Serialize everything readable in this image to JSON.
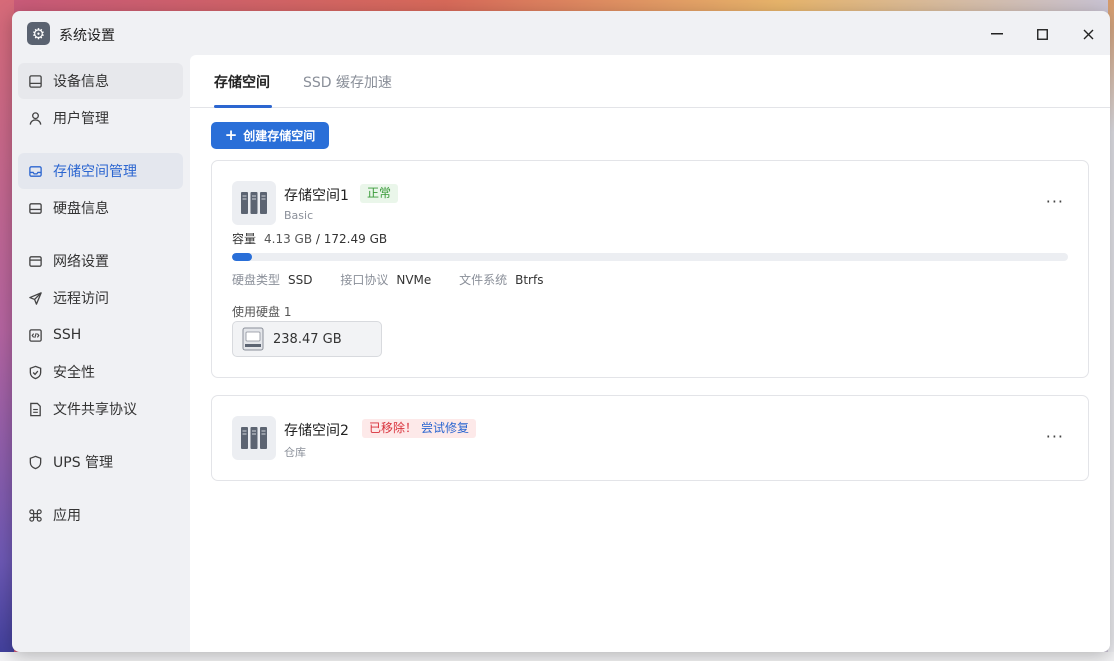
{
  "window": {
    "title": "系统设置",
    "icon": "gear-icon",
    "controls": {
      "minimize": "—",
      "maximize": "☐",
      "close": "✕"
    }
  },
  "sidebar": {
    "items": [
      {
        "id": "device",
        "label": "设备信息",
        "icon": "device-icon"
      },
      {
        "id": "users",
        "label": "用户管理",
        "icon": "user-icon"
      },
      {
        "id": "storage",
        "label": "存储空间管理",
        "icon": "storage-icon"
      },
      {
        "id": "disks",
        "label": "硬盘信息",
        "icon": "disk-icon"
      },
      {
        "id": "network",
        "label": "网络设置",
        "icon": "network-icon"
      },
      {
        "id": "remote",
        "label": "远程访问",
        "icon": "send-icon"
      },
      {
        "id": "ssh",
        "label": "SSH",
        "icon": "code-icon"
      },
      {
        "id": "security",
        "label": "安全性",
        "icon": "shield-check-icon"
      },
      {
        "id": "fileshare",
        "label": "文件共享协议",
        "icon": "file-icon"
      },
      {
        "id": "ups",
        "label": "UPS 管理",
        "icon": "shield-icon"
      },
      {
        "id": "apps",
        "label": "应用",
        "icon": "command-icon"
      }
    ],
    "active": "storage"
  },
  "tabs": [
    {
      "label": "存储空间",
      "active": true
    },
    {
      "label": "SSD 缓存加速",
      "active": false
    }
  ],
  "actions": {
    "create_label": "创建存储空间",
    "create_icon": "plus-icon"
  },
  "pools": [
    {
      "name": "存储空间1",
      "status": "正常",
      "type": "Basic",
      "capacity_label": "容量",
      "used": "4.13 GB",
      "total": "/ 172.49 GB",
      "usage_fraction": 0.024,
      "props": [
        {
          "key": "硬盘类型",
          "value": "SSD"
        },
        {
          "key": "接口协议",
          "value": "NVMe"
        },
        {
          "key": "文件系统",
          "value": "Btrfs"
        }
      ],
      "disks_label": "使用硬盘 1",
      "disk_size": "238.47 GB",
      "more": "···"
    },
    {
      "name": "存储空间2",
      "status": "已移除！",
      "repair_label": "尝试修复",
      "type": "仓库",
      "more": "···"
    }
  ],
  "colors": {
    "accent": "#2a6fd8",
    "ok": "#3a9b3a",
    "error": "#d8303a"
  }
}
